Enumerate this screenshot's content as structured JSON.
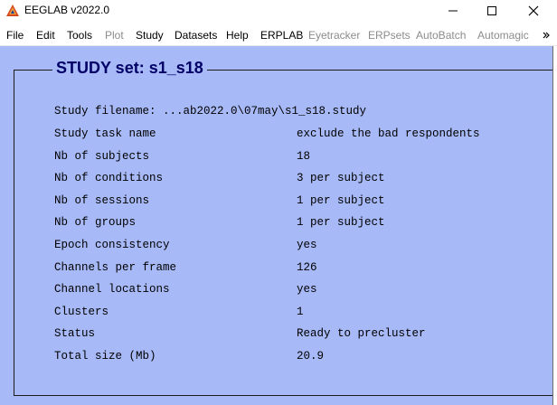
{
  "window": {
    "title": "EEGLAB v2022.0",
    "controls": {
      "minimize": "minimize-icon",
      "maximize": "maximize-icon",
      "close": "close-icon"
    }
  },
  "menu": {
    "items": [
      {
        "label": "File",
        "enabled": true
      },
      {
        "label": "Edit",
        "enabled": true
      },
      {
        "label": "Tools",
        "enabled": true
      },
      {
        "label": "Plot",
        "enabled": false
      },
      {
        "label": "Study",
        "enabled": true
      },
      {
        "label": "Datasets",
        "enabled": true
      },
      {
        "label": "Help",
        "enabled": true
      },
      {
        "label": "ERPLAB",
        "enabled": true
      },
      {
        "label": "Eyetracker",
        "enabled": false
      },
      {
        "label": "ERPsets",
        "enabled": false
      },
      {
        "label": "AutoBatch",
        "enabled": false
      },
      {
        "label": "Automagic",
        "enabled": false
      }
    ],
    "overflow_icon": "chevron-right-icon"
  },
  "study": {
    "title": "STUDY set: s1_s18",
    "filename_line": "Study filename: ...ab2022.0\\07may\\s1_s18.study",
    "rows": [
      {
        "label": "Study task name",
        "value": "exclude the bad respondents"
      },
      {
        "label": "Nb of subjects",
        "value": "18"
      },
      {
        "label": "Nb of conditions",
        "value": "3 per subject"
      },
      {
        "label": "Nb of sessions",
        "value": "1 per subject"
      },
      {
        "label": "Nb of groups",
        "value": "1 per subject"
      },
      {
        "label": "Epoch consistency",
        "value": "yes"
      },
      {
        "label": "Channels per frame",
        "value": "126"
      },
      {
        "label": "Channel locations",
        "value": "yes"
      },
      {
        "label": "Clusters",
        "value": "1"
      },
      {
        "label": "Status",
        "value": "Ready to precluster"
      },
      {
        "label": "Total size (Mb)",
        "value": "20.9"
      }
    ]
  },
  "colors": {
    "panel_background": "#a7b9f7",
    "title_color": "#000066",
    "disabled_menu": "#8c8c8c"
  }
}
